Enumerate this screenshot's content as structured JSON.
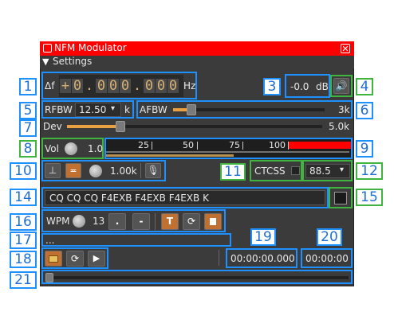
{
  "window": {
    "title": "NFM Modulator",
    "settings_label": "Settings"
  },
  "freq": {
    "label": "Δf",
    "sign": "+",
    "digits": [
      "0",
      "0",
      "0",
      "0",
      "0",
      "0",
      "0"
    ],
    "separators": [
      ".",
      "."
    ],
    "unit": "Hz"
  },
  "channel_power": {
    "value": "-0.0",
    "unit": "dB"
  },
  "rfbw": {
    "label": "RFBW",
    "value": "12.50",
    "unit": "k"
  },
  "afbw": {
    "label": "AFBW",
    "value": "3k",
    "level": 0.12
  },
  "dev": {
    "label": "Dev",
    "value": "5.0k",
    "level": 0.21
  },
  "vol": {
    "label": "Vol",
    "value": "1.0",
    "ticks": [
      "25",
      "50",
      "75",
      "100"
    ]
  },
  "tone": {
    "freq": "1.00k"
  },
  "ctcss": {
    "label": "CTCSS",
    "value": "88.5"
  },
  "morse": {
    "text": "CQ CQ CQ F4EXB F4EXB F4EXB K",
    "wpm_label": "WPM",
    "wpm": "13",
    "dot": ".",
    "dash": "-",
    "text_button": "T"
  },
  "file": {
    "name": "...",
    "time_elapsed": "00:00:00.000",
    "time_total": "00:00:00"
  },
  "callouts": [
    "1",
    "2",
    "3",
    "4",
    "5",
    "6",
    "7",
    "8",
    "9",
    "10",
    "11",
    "12",
    "13",
    "14",
    "15",
    "16",
    "17",
    "18",
    "19",
    "20",
    "21"
  ],
  "colors": {
    "title_bar": "#ff0000",
    "panel": "#3b3b3b",
    "highlight_blue": "#1e90ff",
    "highlight_green": "#3fb43f",
    "digit_text": "#d8b070",
    "slider_fill": "#e8a040",
    "vu_red": "#ff0000"
  }
}
